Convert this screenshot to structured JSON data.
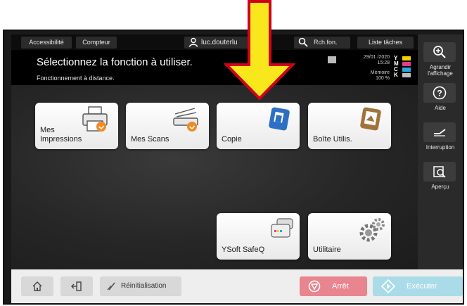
{
  "toolbar": {
    "accessibility": "Accessibilité",
    "counter": "Compteur",
    "user": "luc.douterlu",
    "search": "Rch.fon.",
    "job_list": "Liste tâches"
  },
  "header": {
    "title": "Sélectionnez la fonction à utiliser.",
    "subtitle": "Fonctionnement à distance.",
    "date": "29/01 /2020",
    "time": "15:28",
    "memory_label": "Mémoire",
    "memory_value": "100 %"
  },
  "toner": [
    {
      "letter": "Y",
      "color": "#f5d000"
    },
    {
      "letter": "M",
      "color": "#e23c8b"
    },
    {
      "letter": "C",
      "color": "#2aa8e0"
    },
    {
      "letter": "K",
      "color": "#bfbfbf"
    }
  ],
  "tiles": {
    "print": "Mes Impressions",
    "scans": "Mes Scans",
    "copy": "Copie",
    "box": "Boîte Utilis.",
    "ysoft": "YSoft SafeQ",
    "utility": "Utilitaire"
  },
  "side_panel": {
    "zoom": "Agrandir l'affichage",
    "help": "Aide",
    "interrupt": "Interruption",
    "preview": "Aperçu"
  },
  "bottom": {
    "reset": "Réinitialisation",
    "stop": "Arrêt",
    "start": "Exécuter"
  },
  "colors": {
    "accent_arrow_fill": "#f8e71c",
    "accent_arrow_outline": "#d0021b",
    "stop_button": "#e8858f",
    "start_button": "#a9dce8",
    "orange_badge": "#f08a24"
  }
}
